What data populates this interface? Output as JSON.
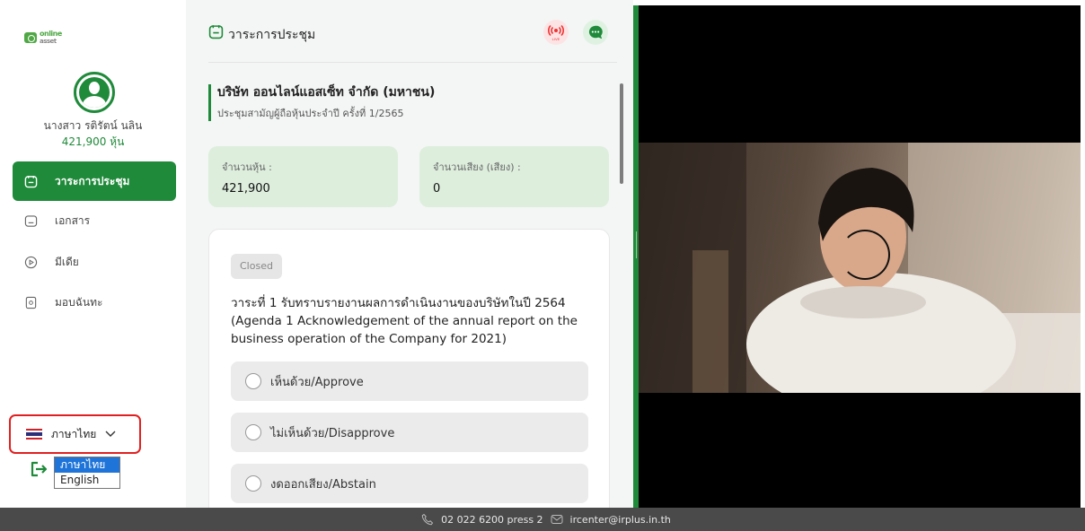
{
  "sidebar": {
    "logo": {
      "line1": "online",
      "line2": "asset"
    },
    "user": {
      "name": "นางสาว รติรัตน์ นลิน",
      "shares": "421,900 หุ้น"
    },
    "nav": [
      {
        "label": "วาระการประชุม",
        "icon": "agenda-icon",
        "active": true
      },
      {
        "label": "เอกสาร",
        "icon": "document-icon",
        "active": false
      },
      {
        "label": "มีเดีย",
        "icon": "play-icon",
        "active": false
      },
      {
        "label": "มอบฉันทะ",
        "icon": "proxy-icon",
        "active": false
      }
    ],
    "language": {
      "selected": "ภาษาไทย",
      "options": [
        "ภาษาไทย",
        "English"
      ]
    }
  },
  "center": {
    "title": "วาระการประชุม",
    "company": "บริษัท ออนไลน์แอสเซ็ท จำกัด (มหาชน)",
    "meeting": "ประชุมสามัญผู้ถือหุ้นประจำปี ครั้งที่ 1/2565",
    "stats": [
      {
        "label": "จำนวนหุ้น :",
        "value": "421,900"
      },
      {
        "label": "จำนวนเสียง (เสียง) :",
        "value": "0"
      }
    ],
    "agenda": {
      "status": "Closed",
      "title": "วาระที่ 1 รับทราบรายงานผลการดำเนินงานของบริษัทในปี 2564 (Agenda 1 Acknowledgement of the annual report on the business operation of the Company for 2021)",
      "options": [
        "เห็นด้วย/Approve",
        "ไม่เห็นด้วย/Disapprove",
        "งดออกเสียง/Abstain"
      ]
    },
    "live_badge": "LIVE"
  },
  "footer": {
    "phone": "02 022 6200 press 2",
    "email": "ircenter@irplus.in.th"
  },
  "colors": {
    "brand_green": "#1f8a3a",
    "highlight_red": "#e02020",
    "footer_bg": "#4a4a4a"
  }
}
